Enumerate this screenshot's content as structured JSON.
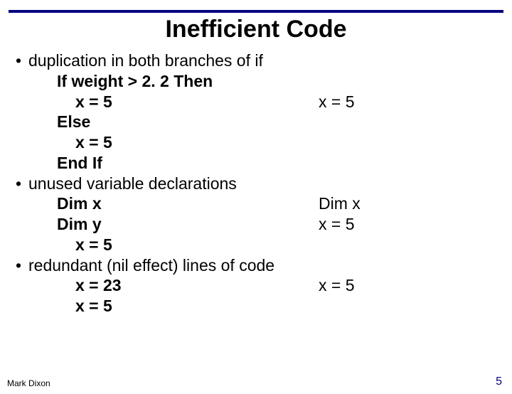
{
  "title": "Inefficient Code",
  "bullets": {
    "b1": "duplication in both branches of if",
    "b2": "unused variable declarations",
    "b3": "redundant (nil effect) lines of code"
  },
  "code1": {
    "l1": "If weight > 2. 2 Then",
    "l2": "x = 5",
    "l3": "Else",
    "l4": "x = 5",
    "l5": "End If",
    "r1": "x = 5"
  },
  "code2": {
    "l1": "Dim x",
    "l2": "Dim y",
    "l3": "x = 5",
    "r1": "Dim x",
    "r2": "x = 5"
  },
  "code3": {
    "l1": "x = 23",
    "l2": "x = 5",
    "r1": "x = 5"
  },
  "footer": {
    "author": "Mark Dixon",
    "page": "5"
  }
}
